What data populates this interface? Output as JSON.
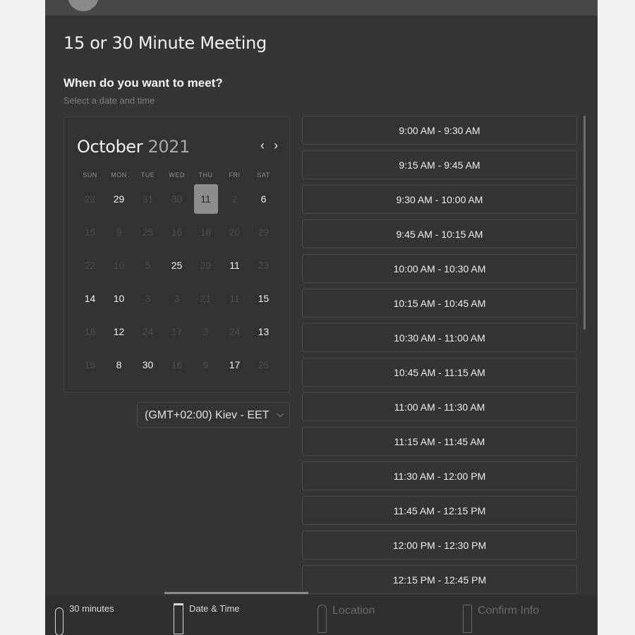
{
  "page": {
    "title": "15 or 30 Minute Meeting",
    "question": "When do you want to meet?",
    "hint": "Select a date and time"
  },
  "calendar": {
    "month": "October",
    "year": "2021",
    "prev_icon": "chevron-left-icon",
    "next_icon": "chevron-right-icon",
    "prev_glyph": "‹",
    "next_glyph": "›",
    "weekdays": [
      "SUN",
      "MON",
      "TUE",
      "WED",
      "THU",
      "FRI",
      "SAT"
    ],
    "weeks": [
      [
        {
          "d": "22",
          "on": false
        },
        {
          "d": "29",
          "on": true
        },
        {
          "d": "31",
          "on": false
        },
        {
          "d": "30",
          "on": false
        },
        {
          "d": "11",
          "on": true,
          "sel": true
        },
        {
          "d": "2",
          "on": false
        },
        {
          "d": "6",
          "on": true
        }
      ],
      [
        {
          "d": "15",
          "on": false
        },
        {
          "d": "9",
          "on": false
        },
        {
          "d": "25",
          "on": false
        },
        {
          "d": "16",
          "on": false
        },
        {
          "d": "18",
          "on": false
        },
        {
          "d": "20",
          "on": false
        },
        {
          "d": "29",
          "on": false
        }
      ],
      [
        {
          "d": "22",
          "on": false
        },
        {
          "d": "10",
          "on": false
        },
        {
          "d": "5",
          "on": false
        },
        {
          "d": "25",
          "on": true
        },
        {
          "d": "29",
          "on": false
        },
        {
          "d": "11",
          "on": true
        },
        {
          "d": "23",
          "on": false
        }
      ],
      [
        {
          "d": "14",
          "on": true
        },
        {
          "d": "10",
          "on": true
        },
        {
          "d": "3",
          "on": false
        },
        {
          "d": "3",
          "on": false
        },
        {
          "d": "21",
          "on": false
        },
        {
          "d": "11",
          "on": false
        },
        {
          "d": "15",
          "on": true
        }
      ],
      [
        {
          "d": "18",
          "on": false
        },
        {
          "d": "12",
          "on": true
        },
        {
          "d": "24",
          "on": false
        },
        {
          "d": "17",
          "on": false
        },
        {
          "d": "3",
          "on": false
        },
        {
          "d": "24",
          "on": false
        },
        {
          "d": "13",
          "on": true
        }
      ],
      [
        {
          "d": "15",
          "on": false
        },
        {
          "d": "8",
          "on": true
        },
        {
          "d": "30",
          "on": true
        },
        {
          "d": "16",
          "on": false
        },
        {
          "d": "9",
          "on": false
        },
        {
          "d": "17",
          "on": true
        },
        {
          "d": "25",
          "on": false
        }
      ]
    ]
  },
  "timezone": {
    "label": "(GMT+02:00) Kiev - EET",
    "icon": "chevron-down-icon",
    "glyph": "⌵"
  },
  "time_slots": [
    "9:00 AM - 9:30 AM",
    "9:15 AM - 9:45 AM",
    "9:30 AM - 10:00 AM",
    "9:45 AM - 10:15 AM",
    "10:00 AM - 10:30 AM",
    "10:15 AM - 10:45 AM",
    "10:30 AM - 11:00 AM",
    "10:45 AM - 11:15 AM",
    "11:00 AM - 11:30 AM",
    "11:15 AM - 11:45 AM",
    "11:30 AM - 12:00 PM",
    "11:45 AM - 12:15 PM",
    "12:00 PM - 12:30 PM",
    "12:15 PM - 12:45 PM"
  ],
  "steps": {
    "duration": {
      "label": "30 minutes",
      "icon": "clock-icon"
    },
    "datetime": {
      "label": "Date & Time",
      "icon": "calendar-icon"
    },
    "location": {
      "label": "Location",
      "icon": "location-pin-icon"
    },
    "confirm": {
      "label": "Confirm Info",
      "icon": "checkbox-icon"
    }
  },
  "colors": {
    "panel": "#353535",
    "page_bg": "#f1f1f1",
    "selected_day": "#8c8c8c"
  }
}
